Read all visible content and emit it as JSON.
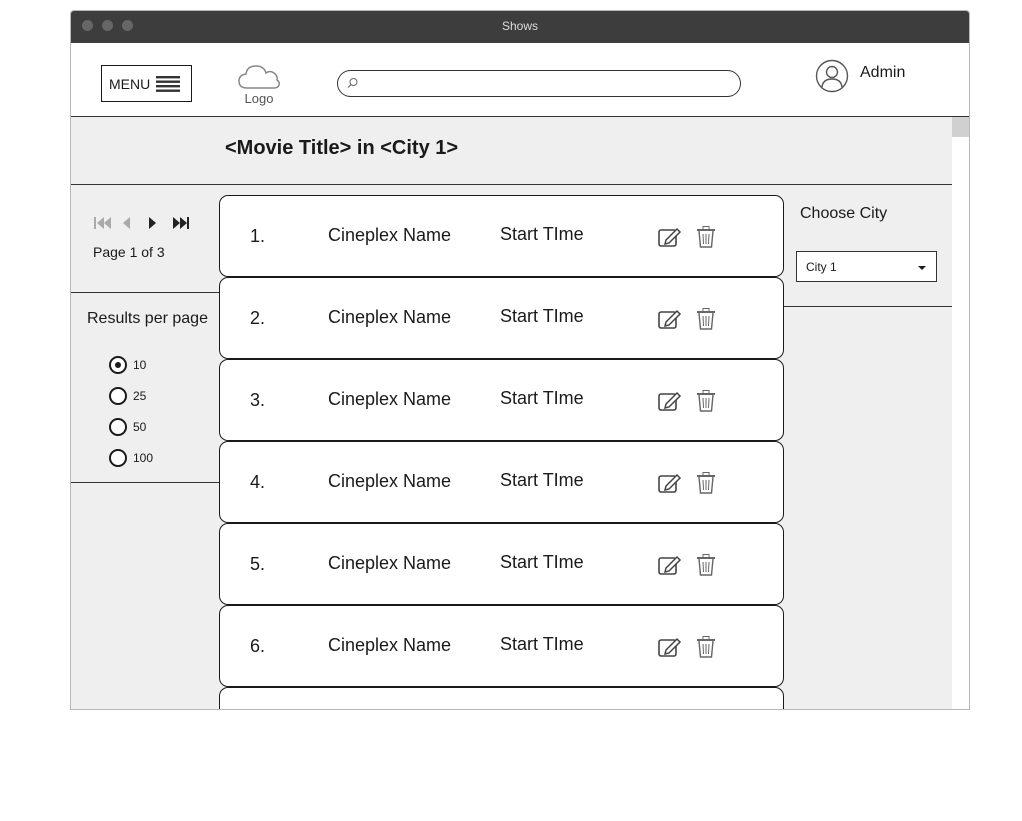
{
  "window": {
    "title": "Shows"
  },
  "header": {
    "menu_label": "MENU",
    "logo_label": "Logo",
    "search_placeholder": "",
    "user_name": "Admin"
  },
  "page": {
    "title": "<Movie Title> in <City 1>"
  },
  "pager": {
    "label": "Page 1 of 3"
  },
  "results_per_page": {
    "title": "Results per page",
    "options": [
      "10",
      "25",
      "50",
      "100"
    ],
    "selected": "10"
  },
  "city": {
    "label": "Choose City",
    "selected": "City 1"
  },
  "rows": [
    {
      "num": "1.",
      "cineplex": "Cineplex Name",
      "time": "Start TIme"
    },
    {
      "num": "2.",
      "cineplex": "Cineplex Name",
      "time": "Start TIme"
    },
    {
      "num": "3.",
      "cineplex": "Cineplex Name",
      "time": "Start TIme"
    },
    {
      "num": "4.",
      "cineplex": "Cineplex Name",
      "time": "Start TIme"
    },
    {
      "num": "5.",
      "cineplex": "Cineplex Name",
      "time": "Start TIme"
    },
    {
      "num": "6.",
      "cineplex": "Cineplex Name",
      "time": "Start TIme"
    }
  ],
  "icons": {
    "menu": "hamburger-icon",
    "logo": "cloud-icon",
    "search": "search-icon",
    "user": "user-icon",
    "first": "first-page-icon",
    "prev": "previous-page-icon",
    "next": "next-page-icon",
    "last": "last-page-icon",
    "edit": "edit-icon",
    "delete": "trash-icon",
    "dropdown": "caret-down-icon"
  },
  "colors": {
    "titlebar": "#3d3d3d",
    "content_bg": "#efefef",
    "row_bg": "#ffffff"
  }
}
